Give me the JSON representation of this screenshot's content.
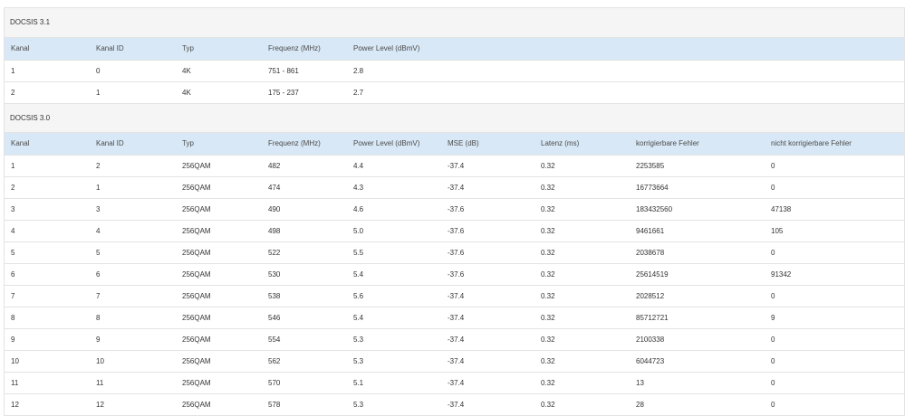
{
  "docsis31": {
    "title": "DOCSIS 3.1",
    "headers": [
      "Kanal",
      "Kanal ID",
      "Typ",
      "Frequenz (MHz)",
      "Power Level (dBmV)"
    ],
    "rows": [
      [
        "1",
        "0",
        "4K",
        "751 - 861",
        "2.8"
      ],
      [
        "2",
        "1",
        "4K",
        "175 - 237",
        "2.7"
      ]
    ]
  },
  "docsis30": {
    "title": "DOCSIS 3.0",
    "headers": [
      "Kanal",
      "Kanal ID",
      "Typ",
      "Frequenz (MHz)",
      "Power Level (dBmV)",
      "MSE (dB)",
      "Latenz (ms)",
      "korrigierbare Fehler",
      "nicht korrigierbare Fehler"
    ],
    "rows": [
      [
        "1",
        "2",
        "256QAM",
        "482",
        "4.4",
        "-37.4",
        "0.32",
        "2253585",
        "0"
      ],
      [
        "2",
        "1",
        "256QAM",
        "474",
        "4.3",
        "-37.4",
        "0.32",
        "16773664",
        "0"
      ],
      [
        "3",
        "3",
        "256QAM",
        "490",
        "4.6",
        "-37.6",
        "0.32",
        "183432560",
        "47138"
      ],
      [
        "4",
        "4",
        "256QAM",
        "498",
        "5.0",
        "-37.6",
        "0.32",
        "9461661",
        "105"
      ],
      [
        "5",
        "5",
        "256QAM",
        "522",
        "5.5",
        "-37.6",
        "0.32",
        "2038678",
        "0"
      ],
      [
        "6",
        "6",
        "256QAM",
        "530",
        "5.4",
        "-37.6",
        "0.32",
        "25614519",
        "91342"
      ],
      [
        "7",
        "7",
        "256QAM",
        "538",
        "5.6",
        "-37.4",
        "0.32",
        "2028512",
        "0"
      ],
      [
        "8",
        "8",
        "256QAM",
        "546",
        "5.4",
        "-37.4",
        "0.32",
        "85712721",
        "9"
      ],
      [
        "9",
        "9",
        "256QAM",
        "554",
        "5.3",
        "-37.4",
        "0.32",
        "2100338",
        "0"
      ],
      [
        "10",
        "10",
        "256QAM",
        "562",
        "5.3",
        "-37.4",
        "0.32",
        "6044723",
        "0"
      ],
      [
        "11",
        "11",
        "256QAM",
        "570",
        "5.1",
        "-37.4",
        "0.32",
        "13",
        "0"
      ],
      [
        "12",
        "12",
        "256QAM",
        "578",
        "5.3",
        "-37.4",
        "0.32",
        "28",
        "0"
      ]
    ]
  },
  "colors": {
    "section_bg": "#f5f5f5",
    "header_bg": "#d8e8f6",
    "border": "#e3e3e3",
    "text": "#333333"
  }
}
